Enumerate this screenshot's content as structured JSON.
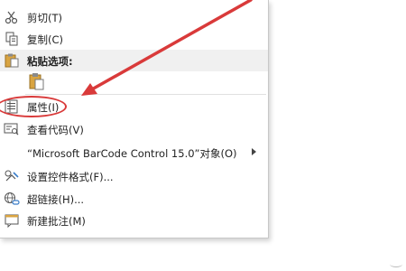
{
  "context_menu": {
    "cut_label": "剪切(T)",
    "copy_label": "复制(C)",
    "paste_options_label": "粘贴选项:",
    "properties_label": "属性(I)",
    "view_code_label": "查看代码(V)",
    "object_label": "“Microsoft BarCode Control 15.0”对象(O)",
    "format_control_label": "设置控件格式(F)...",
    "hyperlink_label": "超链接(H)...",
    "new_comment_label": "新建批注(M)"
  },
  "icons": {
    "cut": "scissors-icon",
    "copy": "copy-icon",
    "paste": "clipboard-icon",
    "properties": "properties-icon",
    "view_code": "view-code-icon",
    "format_control": "format-control-icon",
    "hyperlink": "hyperlink-icon",
    "new_comment": "new-comment-icon"
  },
  "colors": {
    "annotation_red": "#d93a3a",
    "menu_background": "#ffffff",
    "paste_header_background": "#f0f0f0"
  }
}
